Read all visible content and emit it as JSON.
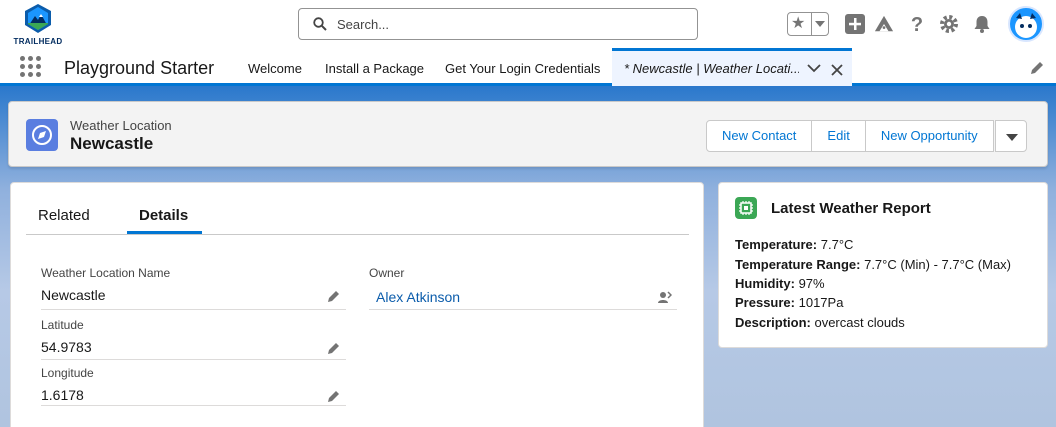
{
  "brand": {
    "logo_text": "TRAILHEAD"
  },
  "search": {
    "placeholder": "Search..."
  },
  "nav": {
    "app_name": "Playground Starter",
    "items": [
      {
        "label": "Welcome"
      },
      {
        "label": "Install a Package"
      },
      {
        "label": "Get Your Login Credentials"
      }
    ],
    "active_tab": {
      "label": "* Newcastle | Weather Locati..."
    }
  },
  "record": {
    "object_type": "Weather Location",
    "name": "Newcastle",
    "actions": {
      "new_contact": "New Contact",
      "edit": "Edit",
      "new_opportunity": "New Opportunity"
    }
  },
  "tabs": {
    "related": "Related",
    "details": "Details"
  },
  "fields": {
    "name": {
      "label": "Weather Location Name",
      "value": "Newcastle"
    },
    "latitude": {
      "label": "Latitude",
      "value": "54.9783"
    },
    "longitude": {
      "label": "Longitude",
      "value": "1.6178"
    },
    "owner": {
      "label": "Owner",
      "value": "Alex Atkinson"
    }
  },
  "weather": {
    "title": "Latest Weather Report",
    "temperature": {
      "label": "Temperature:",
      "value": "7.7°C"
    },
    "range": {
      "label": "Temperature Range:",
      "value": "7.7°C (Min) - 7.7°C (Max)"
    },
    "humidity": {
      "label": "Humidity:",
      "value": "97%"
    },
    "pressure": {
      "label": "Pressure:",
      "value": "1017Pa"
    },
    "description": {
      "label": "Description:",
      "value": "overcast clouds"
    }
  },
  "colors": {
    "brand_blue": "#0176d3",
    "link": "#0b5cab",
    "record_icon": "#5a7ee0",
    "weather_icon": "#3ba755"
  }
}
